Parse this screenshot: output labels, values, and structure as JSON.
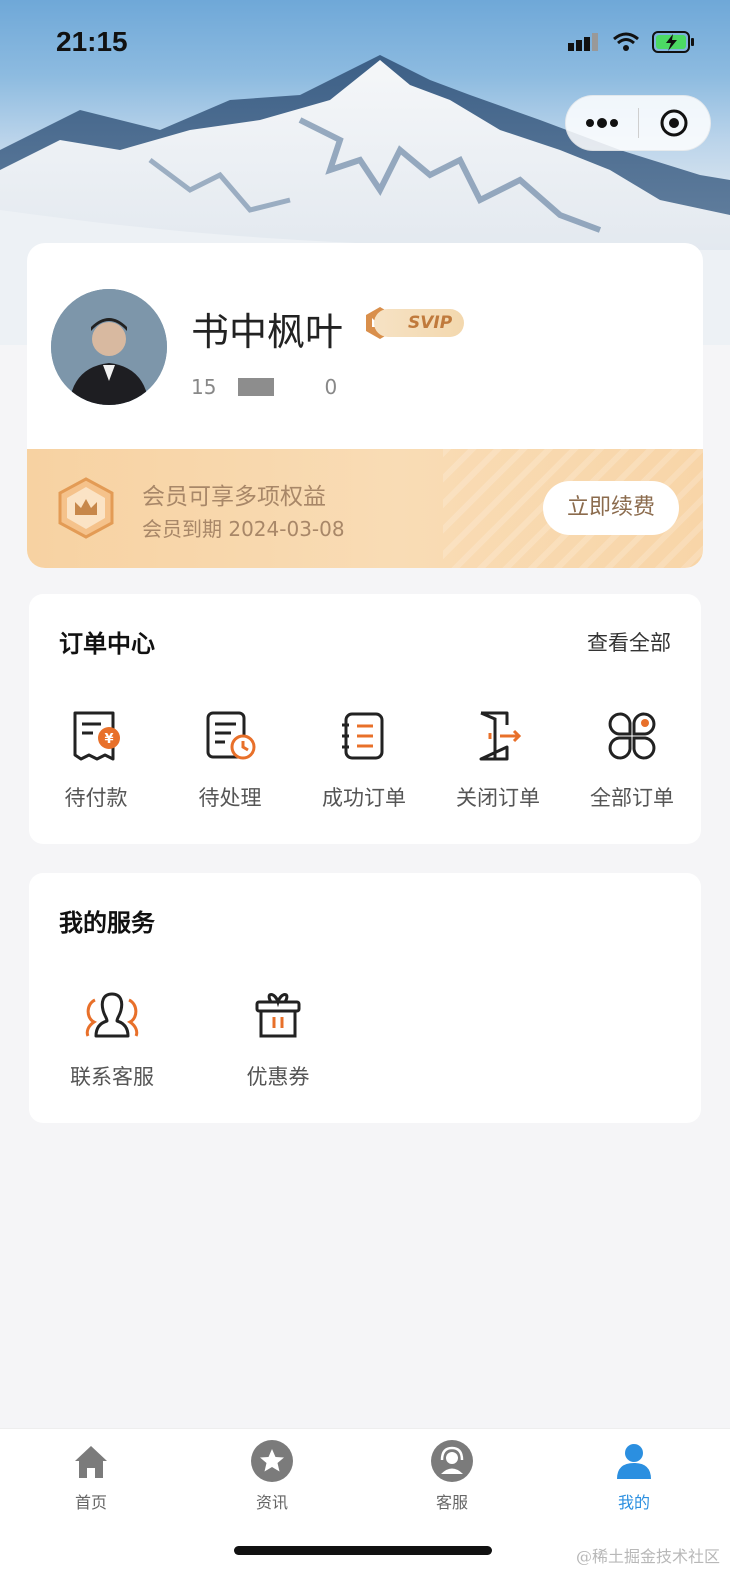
{
  "status_bar": {
    "time": "21:15",
    "icons": [
      "signal-icon",
      "wifi-icon",
      "battery-charging-icon"
    ]
  },
  "capsule": {
    "more_icon": "more-dots-icon",
    "close_icon": "target-close-icon"
  },
  "profile": {
    "nickname": "书中枫叶",
    "badge": "SVIP",
    "phone_prefix": "15",
    "phone_suffix": "0"
  },
  "vip": {
    "title": "会员可享多项权益",
    "expire": "会员到期 2024-03-08",
    "renew_label": "立即续费"
  },
  "orders": {
    "title": "订单中心",
    "view_all": "查看全部",
    "items": [
      {
        "label": "待付款",
        "icon": "pending-payment-icon"
      },
      {
        "label": "待处理",
        "icon": "pending-process-icon"
      },
      {
        "label": "成功订单",
        "icon": "success-order-icon"
      },
      {
        "label": "关闭订单",
        "icon": "closed-order-icon"
      },
      {
        "label": "全部订单",
        "icon": "all-orders-icon"
      }
    ]
  },
  "services": {
    "title": "我的服务",
    "items": [
      {
        "label": "联系客服",
        "icon": "customer-service-icon"
      },
      {
        "label": "优惠券",
        "icon": "coupon-icon"
      }
    ]
  },
  "tabbar": {
    "items": [
      {
        "label": "首页",
        "icon": "home-icon"
      },
      {
        "label": "资讯",
        "icon": "star-news-icon"
      },
      {
        "label": "客服",
        "icon": "headset-icon"
      },
      {
        "label": "我的",
        "icon": "user-icon",
        "active": true
      }
    ]
  },
  "colors": {
    "accent": "#2b8fe0",
    "vip_gold": "#f7d2a2",
    "icon_orange": "#e8702a"
  },
  "watermark": "@稀土掘金技术社区"
}
